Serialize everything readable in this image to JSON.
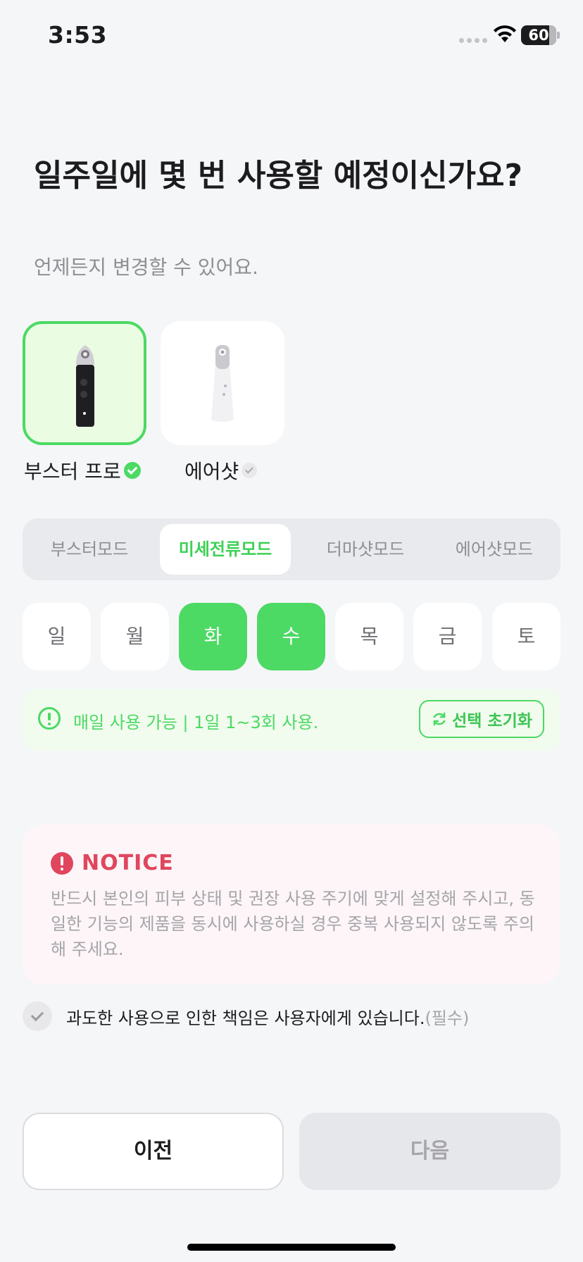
{
  "status_bar": {
    "time": "3:53",
    "battery": "60"
  },
  "header": {
    "title": "일주일에 몇 번 사용할 예정이신가요?",
    "subtitle": "언제든지 변경할 수 있어요."
  },
  "devices": [
    {
      "name": "부스터 프로",
      "selected": true,
      "icon": "booster-pro-device-icon"
    },
    {
      "name": "에어샷",
      "selected": false,
      "icon": "airshot-device-icon"
    }
  ],
  "modes": [
    {
      "label": "부스터모드",
      "active": false
    },
    {
      "label": "미세전류모드",
      "active": true
    },
    {
      "label": "더마샷모드",
      "active": false
    },
    {
      "label": "에어샷모드",
      "active": false
    }
  ],
  "days": [
    {
      "label": "일",
      "selected": false
    },
    {
      "label": "월",
      "selected": false
    },
    {
      "label": "화",
      "selected": true
    },
    {
      "label": "수",
      "selected": true
    },
    {
      "label": "목",
      "selected": false
    },
    {
      "label": "금",
      "selected": false
    },
    {
      "label": "토",
      "selected": false
    }
  ],
  "info": {
    "text": "매일 사용 가능 | 1일 1~3회 사용.",
    "reset_label": "선택 초기화"
  },
  "notice": {
    "title": "NOTICE",
    "body": "반드시 본인의 피부 상태 및 권장 사용 주기에 맞게 설정해 주시고, 동일한 기능의 제품을 동시에 사용하실 경우 중복 사용되지 않도록 주의해 주세요."
  },
  "agreement": {
    "text": "과도한 사용으로 인한 책임은 사용자에게 있습니다.",
    "required": "(필수)",
    "checked": false
  },
  "footer": {
    "prev_label": "이전",
    "next_label": "다음"
  },
  "colors": {
    "accent": "#4cd964",
    "notice": "#e0465e",
    "background": "#f5f6f8"
  }
}
